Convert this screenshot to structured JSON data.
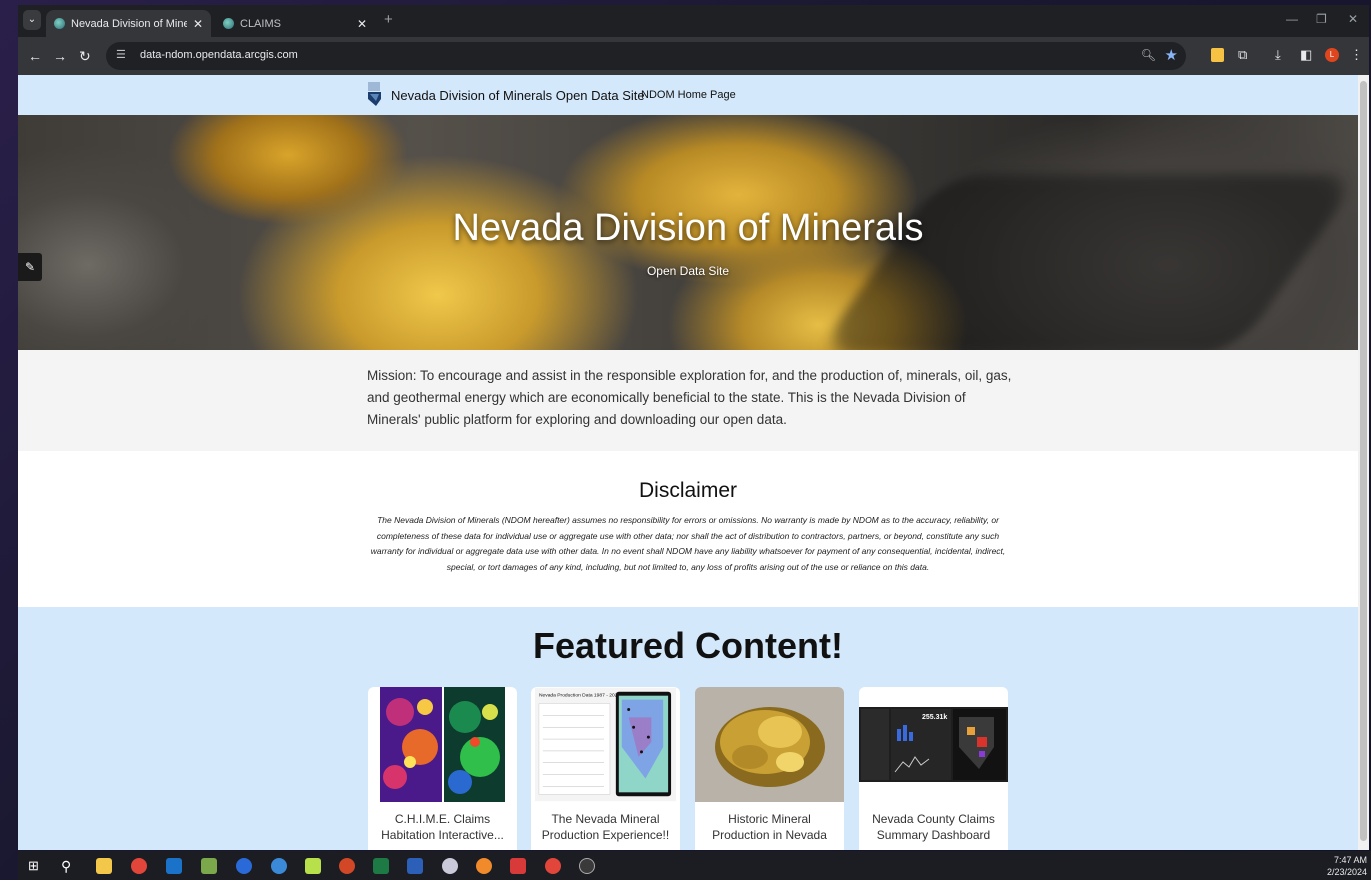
{
  "browser": {
    "tabs": [
      {
        "title": "Nevada Division of Minerals Op",
        "active": true
      },
      {
        "title": "CLAIMS",
        "active": false
      }
    ],
    "url": "data-ndom.opendata.arcgis.com",
    "profile_initial": "L"
  },
  "site": {
    "name": "Nevada Division of Minerals Open Data Site",
    "home_link": "NDOM Home Page"
  },
  "hero": {
    "title": "Nevada Division of Minerals",
    "subtitle": "Open Data Site"
  },
  "mission": "Mission: To encourage and assist in the responsible exploration for, and the production of, minerals, oil, gas, and geothermal energy which are economically beneficial to the state. This is the Nevada Division of Minerals' public platform for exploring and downloading our open data.",
  "disclaimer": {
    "heading": "Disclaimer",
    "text": "The Nevada Division of Minerals (NDOM hereafter) assumes no responsibility for errors or omissions. No warranty is made by NDOM as to the accuracy, reliability, or completeness of these data for individual use or aggregate use with other data; nor shall the act of distribution to contractors, partners, or beyond, constitute any such warranty for individual or aggregate data use with other data. In no event shall NDOM have any liability whatsoever for payment of any consequential, incidental, indirect, special, or tort damages of any kind, including, but not limited to, any loss of profits arising out of the use or reliance on this data."
  },
  "featured": {
    "heading": "Featured Content!",
    "cards": [
      {
        "title": "C.H.I.M.E. Claims Habitation Interactive..."
      },
      {
        "title": "The Nevada Mineral Production Experience!!"
      },
      {
        "title": "Historic Mineral Production in Nevada"
      },
      {
        "title": "Nevada County Claims Summary Dashboard"
      }
    ],
    "card2_thumb_title": "Nevada Production Data 1987 - 2021",
    "card4_thumb_value": "255.31k"
  },
  "taskbar": {
    "time": "7:47 AM",
    "date": "2/23/2024"
  }
}
